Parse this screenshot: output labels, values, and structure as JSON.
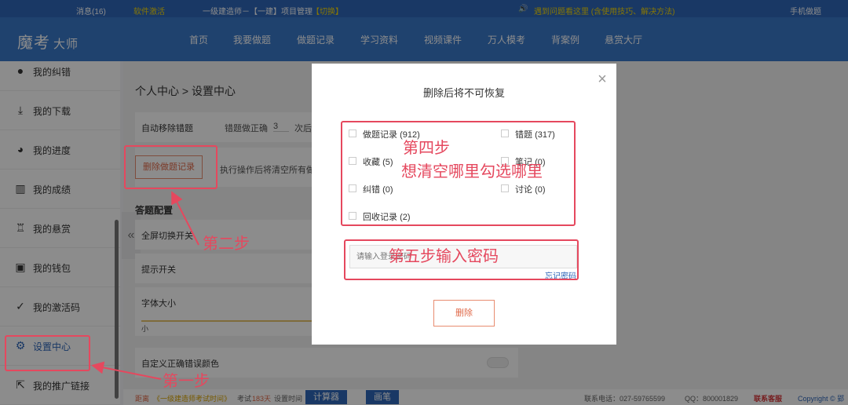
{
  "topbar": {
    "messages": "消息(16)",
    "activate": "软件激活",
    "exam_info": "一级建造师－【一建】项目管理",
    "switch": "【切换】",
    "notice": "遇到问题看这里 (含使用技巧、解决方法)",
    "mobile": "手机做题"
  },
  "navbar": {
    "logo_main": "魔考",
    "logo_sub": "大师",
    "items": [
      "首页",
      "我要做题",
      "做题记录",
      "学习资料",
      "视频课件",
      "万人模考",
      "背案例",
      "悬赏大厅"
    ]
  },
  "sidebar": {
    "items": [
      {
        "label": "我的纠错"
      },
      {
        "label": "我的下载"
      },
      {
        "label": "我的进度"
      },
      {
        "label": "我的成绩"
      },
      {
        "label": "我的悬赏"
      },
      {
        "label": "我的钱包"
      },
      {
        "label": "我的激活码"
      },
      {
        "label": "设置中心"
      },
      {
        "label": "我的推广链接"
      }
    ]
  },
  "main": {
    "breadcrumb": "个人中心 > 设置中心",
    "auto_remove_label": "自动移除错题",
    "correct_count_label": "错题做正确",
    "correct_count_value": "3",
    "times_suffix": "次后",
    "delete_records_button": "删除做题记录",
    "delete_hint": "执行操作后将清空所有做",
    "answer_config_title": "答题配置",
    "fullscreen_label": "全屏切换开关",
    "hint_label": "提示开关",
    "font_size_label": "字体大小",
    "font_size_min": "小",
    "custom_color_label": "自定义正确错误颜色"
  },
  "footer": {
    "countdown_prefix": "距离",
    "countdown_exam": "《一级建造师考试时间》",
    "countdown_mid": "考试",
    "countdown_days": "183天",
    "set_time": "设置时间",
    "calculator": "计算器",
    "brush": "画笔",
    "phone": "联系电话：027-59765599",
    "qq": "QQ：800001829",
    "service": "联系客服",
    "copyright": "Copyright © 郢"
  },
  "modal": {
    "title": "删除后将不可恢复",
    "options": [
      {
        "label": "做题记录",
        "count": "(912)"
      },
      {
        "label": "错题",
        "count": "(317)"
      },
      {
        "label": "收藏",
        "count": "(5)"
      },
      {
        "label": "笔记",
        "count": "(0)"
      },
      {
        "label": "纠错",
        "count": "(0)"
      },
      {
        "label": "讨论",
        "count": "(0)"
      },
      {
        "label": "回收记录",
        "count": "(2)"
      }
    ],
    "password_placeholder": "请输入登录密码",
    "forgot_password": "忘记密码",
    "delete_button": "删除"
  },
  "annotations": {
    "step1": "第一步",
    "step2": "第二步",
    "step4_title": "第四步",
    "step4_desc": "想清空哪里勾选哪里",
    "step5": "第五步输入密码"
  },
  "colors": {
    "brand_blue": "#3a78c9",
    "annotation_red": "#e5485e",
    "action_orange": "#e06a4a"
  }
}
